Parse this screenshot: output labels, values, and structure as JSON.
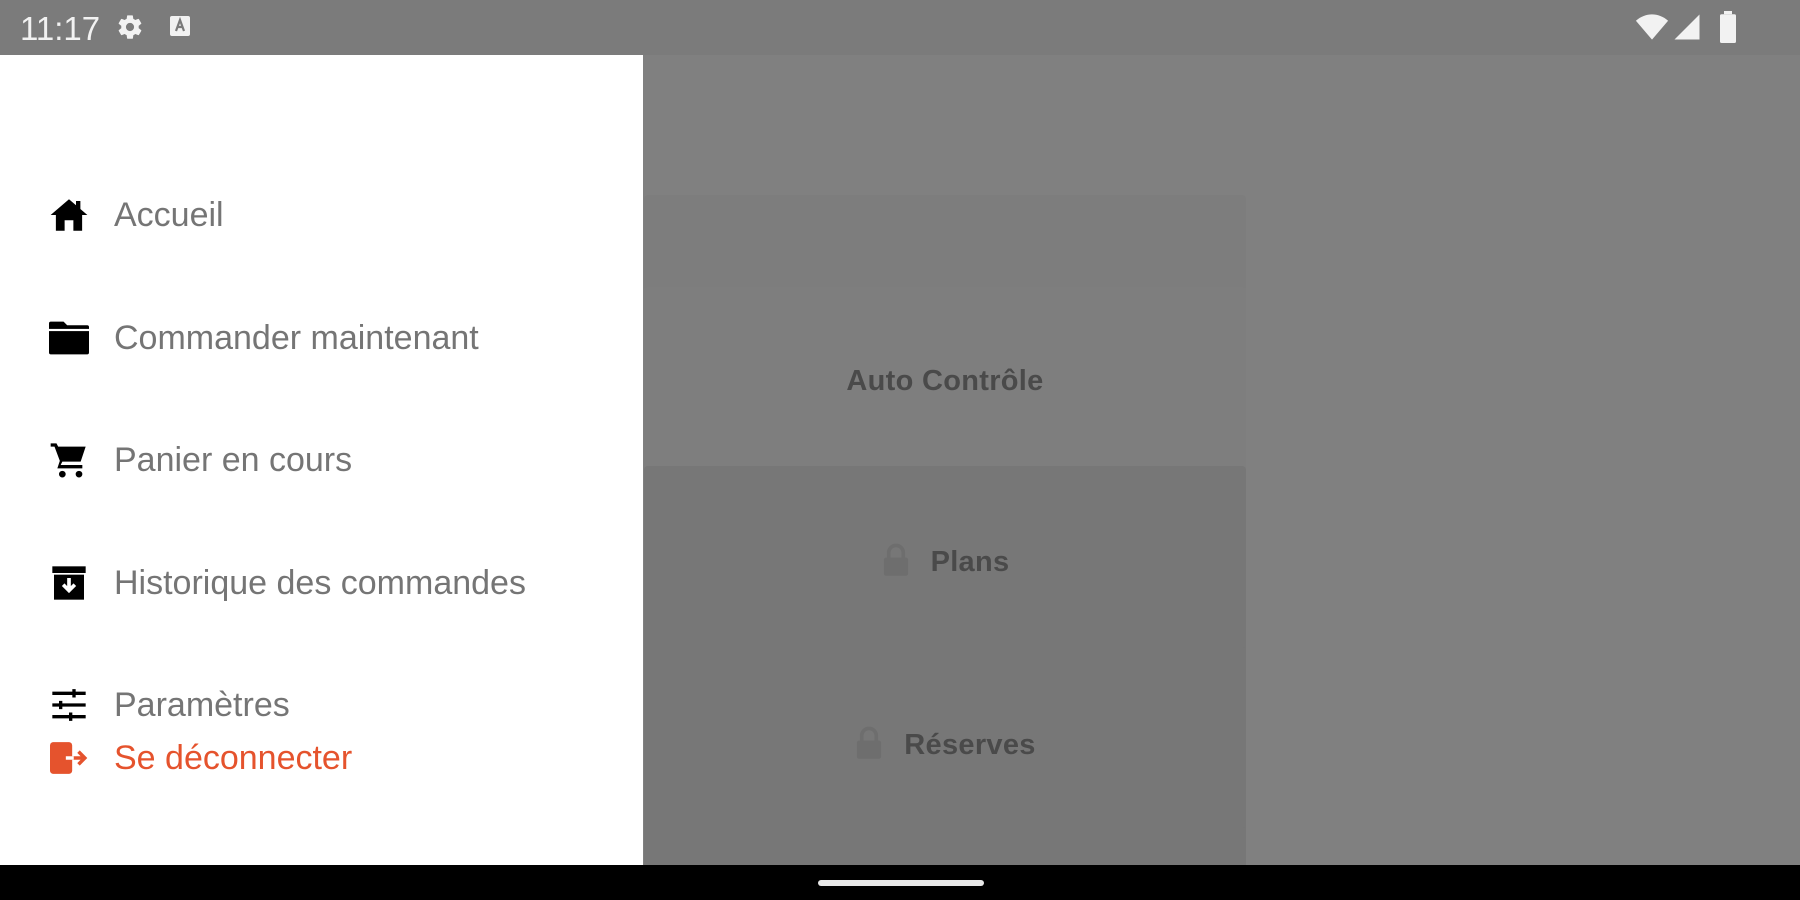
{
  "status_bar": {
    "time": "11:17"
  },
  "background": {
    "cards": [
      {
        "label": "Auto Contrôle",
        "locked": false
      },
      {
        "label": "Plans",
        "locked": true
      },
      {
        "label": "Réserves",
        "locked": true
      }
    ]
  },
  "drawer": {
    "items": [
      {
        "label": "Accueil",
        "icon": "home-icon"
      },
      {
        "label": "Commander maintenant",
        "icon": "folder-icon"
      },
      {
        "label": "Panier en cours",
        "icon": "cart-icon"
      },
      {
        "label": "Historique des commandes",
        "icon": "archive-icon"
      },
      {
        "label": "Paramètres",
        "icon": "tune-icon"
      }
    ],
    "logout": {
      "label": "Se déconnecter",
      "icon": "logout-icon",
      "color": "#e5532d"
    }
  },
  "colors": {
    "scrim": "#808080",
    "drawer_bg": "#ffffff",
    "menu_text": "#757575",
    "accent": "#e5532d"
  }
}
